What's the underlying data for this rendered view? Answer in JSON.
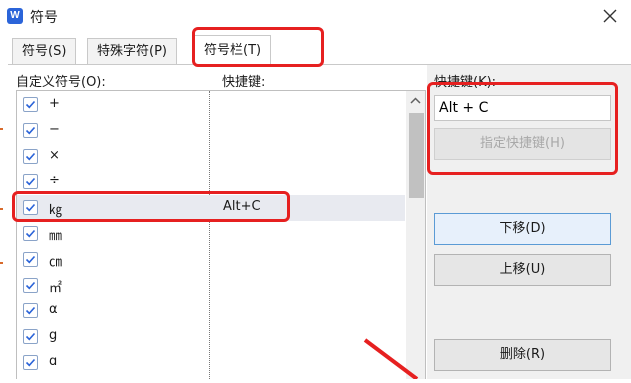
{
  "window": {
    "title": "符号",
    "app_icon_letter": "W"
  },
  "tabs": [
    {
      "label": "符号(S)",
      "active": false
    },
    {
      "label": "特殊字符(P)",
      "active": false
    },
    {
      "label": "符号栏(T)",
      "active": true
    }
  ],
  "list": {
    "column_symbol_label": "自定义符号(O):",
    "column_hotkey_label": "快捷键:",
    "rows": [
      {
        "symbol": "+",
        "hotkey": "",
        "checked": true
      },
      {
        "symbol": "−",
        "hotkey": "",
        "checked": true
      },
      {
        "symbol": "×",
        "hotkey": "",
        "checked": true
      },
      {
        "symbol": "÷",
        "hotkey": "",
        "checked": true
      },
      {
        "symbol": "㎏",
        "hotkey": "Alt+C",
        "checked": true,
        "selected": true
      },
      {
        "symbol": "㎜",
        "hotkey": "",
        "checked": true
      },
      {
        "symbol": "㎝",
        "hotkey": "",
        "checked": true
      },
      {
        "symbol": "㎡",
        "hotkey": "",
        "checked": true
      },
      {
        "symbol": "α",
        "hotkey": "",
        "checked": true
      },
      {
        "symbol": "g",
        "hotkey": "",
        "checked": true
      },
      {
        "symbol": "ɑ",
        "hotkey": "",
        "checked": true
      }
    ]
  },
  "shortcut_panel": {
    "label": "快捷键(K):",
    "input_value": "Alt + C",
    "assign_button": "指定快捷键(H)",
    "move_down_button": "下移(D)",
    "move_up_button": "上移(U)",
    "delete_button": "删除(R)"
  },
  "colors": {
    "highlight": "#e62020",
    "accent": "#2b64d9",
    "checkbox_tick": "#2b64d9"
  },
  "icons": [
    "app-icon",
    "close-icon",
    "scroll-up-icon",
    "check-icon",
    "arrow-icon"
  ]
}
